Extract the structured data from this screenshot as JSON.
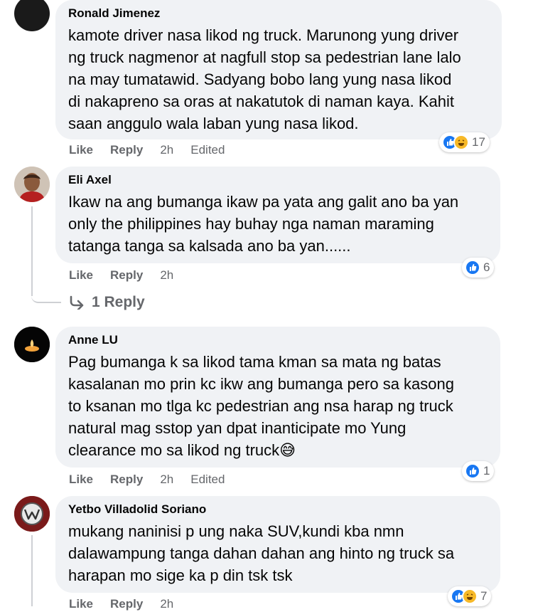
{
  "comments": [
    {
      "author": "Ronald Jimenez",
      "text": "kamote driver nasa likod ng truck. Marunong yung driver\nng truck nagmenor at nagfull stop sa pedestrian lane lalo\nna may tumatawid. Sadyang bobo lang yung nasa likod\ndi nakapreno sa oras at nakatutok di naman kaya. Kahit\nsaan anggulo wala laban yung nasa likod.",
      "like_label": "Like",
      "reply_label": "Reply",
      "time": "2h",
      "edited": "Edited",
      "reaction_count": "17",
      "reactions": [
        "like-icon",
        "haha-icon"
      ]
    },
    {
      "author": "Eli Axel",
      "text": "Ikaw na ang bumanga ikaw pa yata ang galit ano ba yan\nonly the philippines hay buhay nga naman maraming\ntatanga tanga sa kalsada ano ba yan......",
      "like_label": "Like",
      "reply_label": "Reply",
      "time": "2h",
      "reaction_count": "6",
      "reactions": [
        "like-icon"
      ],
      "replies_label": "1 Reply"
    },
    {
      "author": "Anne LU",
      "text": "Pag bumanga k sa likod tama kman sa mata ng batas\nkasalanan mo prin kc ikw ang bumanga pero sa kasong\nto ksanan mo tlga kc pedestrian ang nsa harap ng truck\nnatural mag sstop yan dpat inanticipate mo Yung\nclearance mo sa likod ng truck😅",
      "like_label": "Like",
      "reply_label": "Reply",
      "time": "2h",
      "edited": "Edited",
      "reaction_count": "1",
      "reactions": [
        "like-icon"
      ]
    },
    {
      "author": "Yetbo Villadolid Soriano",
      "text": "mukang naninisi p ung naka SUV,kundi kba nmn\ndalawampung tanga dahan dahan ang hinto ng truck sa\nharapan mo sige ka p din tsk tsk",
      "like_label": "Like",
      "reply_label": "Reply",
      "time": "2h",
      "reaction_count": "7",
      "reactions": [
        "like-icon",
        "haha-icon"
      ]
    }
  ],
  "colors": {
    "bubble": "#f0f2f5",
    "meta": "#65676b",
    "like": "#1877f2",
    "haha": "#f7b928"
  }
}
